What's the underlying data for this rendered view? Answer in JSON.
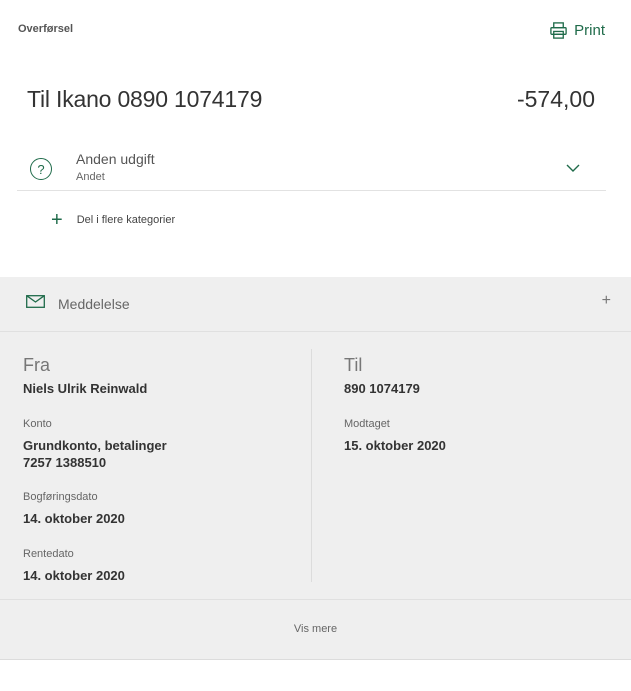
{
  "header": {
    "label": "Overførsel",
    "print_label": "Print",
    "print_icon": "printer-icon"
  },
  "transaction": {
    "title": "Til Ikano 0890 1074179",
    "amount": "-574,00"
  },
  "category": {
    "icon": "question-circle-icon",
    "main": "Anden udgift",
    "sub": "Andet"
  },
  "split": {
    "label": "Del i flere kategorier"
  },
  "message": {
    "label": "Meddelelse",
    "icon": "envelope-icon",
    "expand": "+"
  },
  "from": {
    "heading": "Fra",
    "name": "Niels Ulrik Reinwald",
    "account_label": "Konto",
    "account_name": "Grundkonto, betalinger",
    "account_number": "7257 1388510",
    "booking_label": "Bogføringsdato",
    "booking_date": "14. oktober 2020",
    "interest_label": "Rentedato",
    "interest_date": "14. oktober 2020"
  },
  "to": {
    "heading": "Til",
    "account": "890 1074179",
    "received_label": "Modtaget",
    "received_date": "15. oktober 2020"
  },
  "footer": {
    "more_label": "Vis mere"
  },
  "colors": {
    "accent": "#1f6b4a",
    "panel": "#efefef"
  }
}
